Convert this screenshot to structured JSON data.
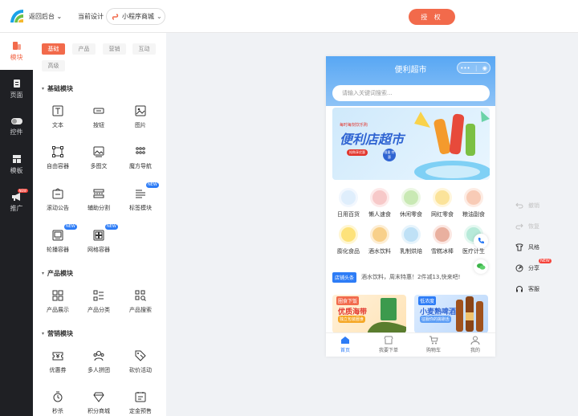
{
  "header": {
    "back_label": "返回后台",
    "current_design_label": "当前设计",
    "design_select_value": "小程序商城",
    "authorize_label": "授 权"
  },
  "rail": [
    {
      "label": "模块",
      "icon": "module-icon",
      "active": true
    },
    {
      "label": "页面",
      "icon": "page-icon"
    },
    {
      "label": "控件",
      "icon": "toggle-icon"
    },
    {
      "label": "模板",
      "icon": "template-icon"
    },
    {
      "label": "推广",
      "icon": "megaphone-icon",
      "badge": "NEW"
    }
  ],
  "panel": {
    "tabs": [
      "基础",
      "产品",
      "营销",
      "互动",
      "高级"
    ],
    "sections": {
      "basic": {
        "title": "基础模块",
        "items": [
          {
            "label": "文本",
            "icon": "text-icon"
          },
          {
            "label": "按钮",
            "icon": "button-icon"
          },
          {
            "label": "图片",
            "icon": "image-icon"
          },
          {
            "label": "自由容器",
            "icon": "free-container-icon"
          },
          {
            "label": "多图文",
            "icon": "multi-image-text-icon"
          },
          {
            "label": "魔方导航",
            "icon": "grid-nav-icon"
          },
          {
            "label": "滚动公告",
            "icon": "notice-icon"
          },
          {
            "label": "辅助分割",
            "icon": "divider-icon"
          },
          {
            "label": "标签模块",
            "icon": "tag-module-icon",
            "badge": "NEW"
          },
          {
            "label": "轮播容器",
            "icon": "carousel-icon",
            "badge": "NEW"
          },
          {
            "label": "网格容器",
            "icon": "grid-container-icon",
            "badge": "NEW"
          }
        ]
      },
      "product": {
        "title": "产品模块",
        "items": [
          {
            "label": "产品展示",
            "icon": "product-display-icon"
          },
          {
            "label": "产品分类",
            "icon": "product-category-icon"
          },
          {
            "label": "产品搜索",
            "icon": "product-search-icon"
          }
        ]
      },
      "marketing": {
        "title": "营销模块",
        "items": [
          {
            "label": "优惠券",
            "icon": "coupon-icon"
          },
          {
            "label": "多人拼团",
            "icon": "group-buy-icon"
          },
          {
            "label": "砍价活动",
            "icon": "bargain-icon"
          },
          {
            "label": "秒杀",
            "icon": "flash-sale-icon"
          },
          {
            "label": "积分商城",
            "icon": "points-mall-icon"
          },
          {
            "label": "定金预售",
            "icon": "presale-icon"
          }
        ]
      }
    }
  },
  "phone": {
    "title": "便利超市",
    "search_placeholder": "请输入关键词搜索...",
    "banner": {
      "kicker": "每时每刻饮乐购",
      "headline": "便利店超市",
      "cta": "抢购享优惠",
      "seal": "限量 特惠"
    },
    "categories": [
      {
        "label": "日用百货",
        "color": "#e9f1fb"
      },
      {
        "label": "懒人速食",
        "color": "#fbe3e3"
      },
      {
        "label": "休闲零食",
        "color": "#e4f5d9"
      },
      {
        "label": "网红零食",
        "color": "#fff3cf"
      },
      {
        "label": "粮油副食",
        "color": "#fde7dc"
      },
      {
        "label": "膨化食品",
        "color": "#fff3cf"
      },
      {
        "label": "酒水饮料",
        "color": "#fde9c9"
      },
      {
        "label": "乳制烘焙",
        "color": "#e0f1fb"
      },
      {
        "label": "雪糕冰棒",
        "color": "#fde3e3"
      },
      {
        "label": "医疗计生",
        "color": "#dff6f0"
      }
    ],
    "news": {
      "tag": "店铺头条",
      "text": "酒水饮料，周末特惠！2件减13,快来吧!"
    },
    "promos": [
      {
        "tag": "圈食下饭",
        "title": "优质海带",
        "sub": "独立包装圈食"
      },
      {
        "tag": "低浓度",
        "title": "小麦熟啤酒",
        "sub": "征服你的挑剔舌"
      }
    ],
    "tabbar": [
      "首页",
      "我要下单",
      "购物车",
      "我的"
    ]
  },
  "actions": [
    {
      "label": "撤销",
      "icon": "undo-icon",
      "disabled": true
    },
    {
      "label": "恢复",
      "icon": "redo-icon",
      "disabled": true
    },
    {
      "label": "风格",
      "icon": "style-icon"
    },
    {
      "label": "分享",
      "icon": "share-icon",
      "badge": "NEW"
    },
    {
      "label": "客服",
      "icon": "headset-icon"
    }
  ],
  "colors": {
    "accent": "#f26a4b",
    "blue": "#2d7cf6",
    "rail": "#1f2024"
  }
}
